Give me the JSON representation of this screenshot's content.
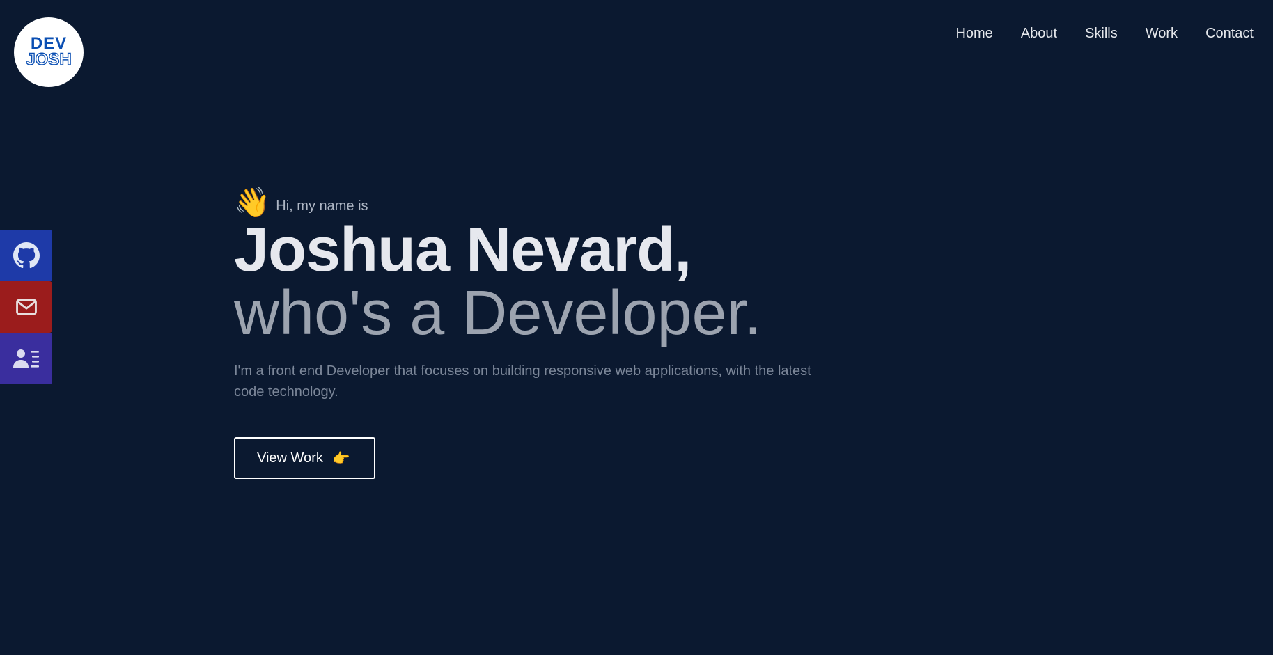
{
  "logo": {
    "line1": "DEV",
    "line2": "JOSH"
  },
  "nav": {
    "items": [
      {
        "label": "Home"
      },
      {
        "label": "About"
      },
      {
        "label": "Skills"
      },
      {
        "label": "Work"
      },
      {
        "label": "Contact"
      }
    ]
  },
  "social": {
    "items": [
      {
        "icon": "github-icon",
        "color": "#1e3aa8"
      },
      {
        "icon": "mail-icon",
        "color": "#9b1c1c"
      },
      {
        "icon": "contact-card-icon",
        "color": "#3a2e9e"
      }
    ]
  },
  "hero": {
    "wave_icon": "👋",
    "greeting": "Hi, my name is",
    "name": "Joshua Nevard,",
    "role": "who's a Developer.",
    "description": "I'm a front end Developer that focuses on building responsive web applications, with the latest code technology.",
    "cta_label": "View Work",
    "cta_icon": "👉"
  },
  "colors": {
    "background": "#0b1930",
    "brand_blue": "#0b4fb3"
  }
}
